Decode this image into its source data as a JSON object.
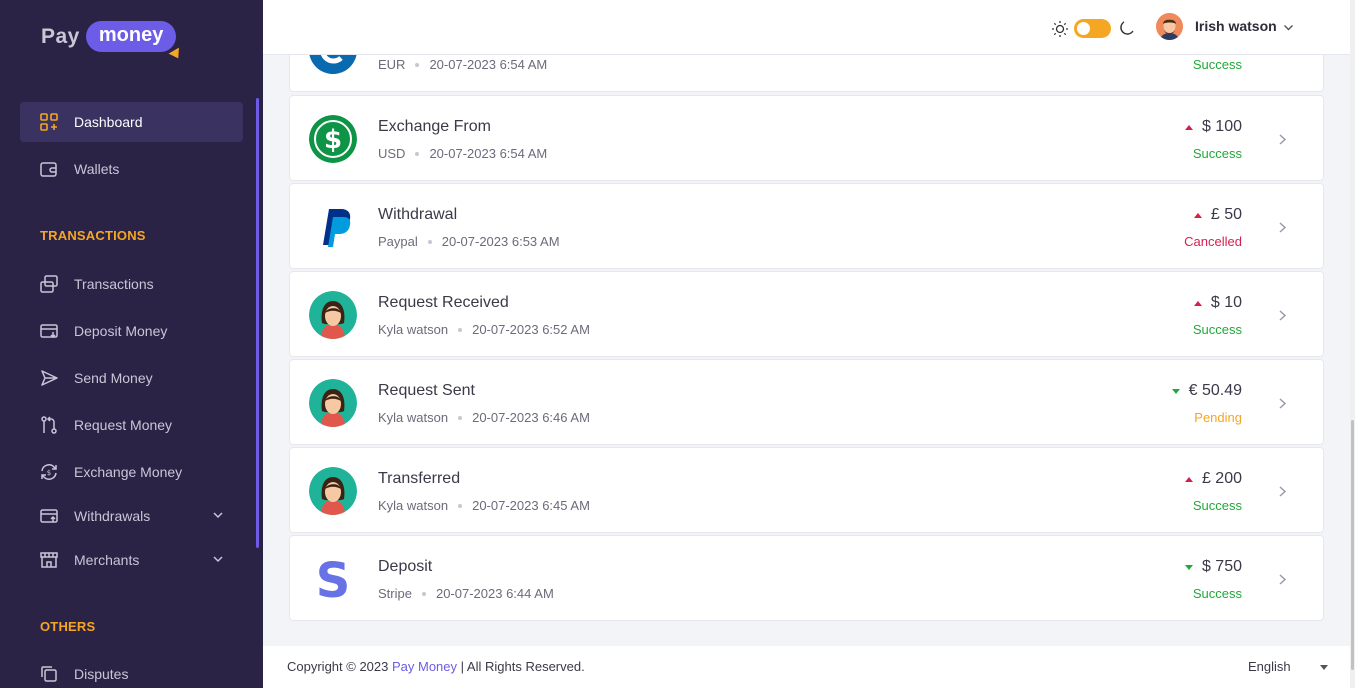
{
  "brand": {
    "pay": "Pay",
    "money": "money"
  },
  "sidebar": {
    "items": [
      {
        "label": "Dashboard"
      },
      {
        "label": "Wallets"
      },
      {
        "label": "Transactions"
      },
      {
        "label": "Deposit Money"
      },
      {
        "label": "Send Money"
      },
      {
        "label": "Request Money"
      },
      {
        "label": "Exchange Money"
      },
      {
        "label": "Withdrawals"
      },
      {
        "label": "Merchants"
      },
      {
        "label": "Disputes"
      }
    ],
    "section_transactions": "TRANSACTIONS",
    "section_others": "OTHERS"
  },
  "header": {
    "user_name": "Irish watson",
    "theme": "light"
  },
  "transactions": [
    {
      "title": "",
      "sub_left": "EUR",
      "date": "20-07-2023 6:54 AM",
      "amount": "",
      "status": "Success",
      "status_color": "#22a83a",
      "icon": "euro-icon"
    },
    {
      "title": "Exchange From",
      "sub_left": "USD",
      "date": "20-07-2023 6:54 AM",
      "amount": "$ 100",
      "direction": "up",
      "status": "Success",
      "status_color": "#22a83a",
      "icon": "dollar-icon"
    },
    {
      "title": "Withdrawal",
      "sub_left": "Paypal",
      "date": "20-07-2023 6:53 AM",
      "amount": "£ 50",
      "direction": "up",
      "status": "Cancelled",
      "status_color": "#d6204c",
      "icon": "paypal-icon"
    },
    {
      "title": "Request Received",
      "sub_left": "Kyla watson",
      "date": "20-07-2023 6:52 AM",
      "amount": "$ 10",
      "direction": "up",
      "status": "Success",
      "status_color": "#22a83a",
      "icon": "user-avatar-icon"
    },
    {
      "title": "Request Sent",
      "sub_left": "Kyla watson",
      "date": "20-07-2023 6:46 AM",
      "amount": "€ 50.49",
      "direction": "down",
      "status": "Pending",
      "status_color": "#f5a623",
      "icon": "user-avatar-icon"
    },
    {
      "title": "Transferred",
      "sub_left": "Kyla watson",
      "date": "20-07-2023 6:45 AM",
      "amount": "£ 200",
      "direction": "up",
      "status": "Success",
      "status_color": "#22a83a",
      "icon": "user-avatar-icon"
    },
    {
      "title": "Deposit",
      "sub_left": "Stripe",
      "date": "20-07-2023 6:44 AM",
      "amount": "$ 750",
      "direction": "down",
      "status": "Success",
      "status_color": "#22a83a",
      "icon": "stripe-icon"
    }
  ],
  "footer": {
    "copyright_prefix": "Copyright © 2023",
    "brand": "Pay Money",
    "copyright_suffix": "| All Rights Reserved.",
    "language": "English"
  },
  "colors": {
    "accent": "#6c5ce7",
    "sidebar_bg": "#2a2346",
    "section": "#f5a623"
  }
}
